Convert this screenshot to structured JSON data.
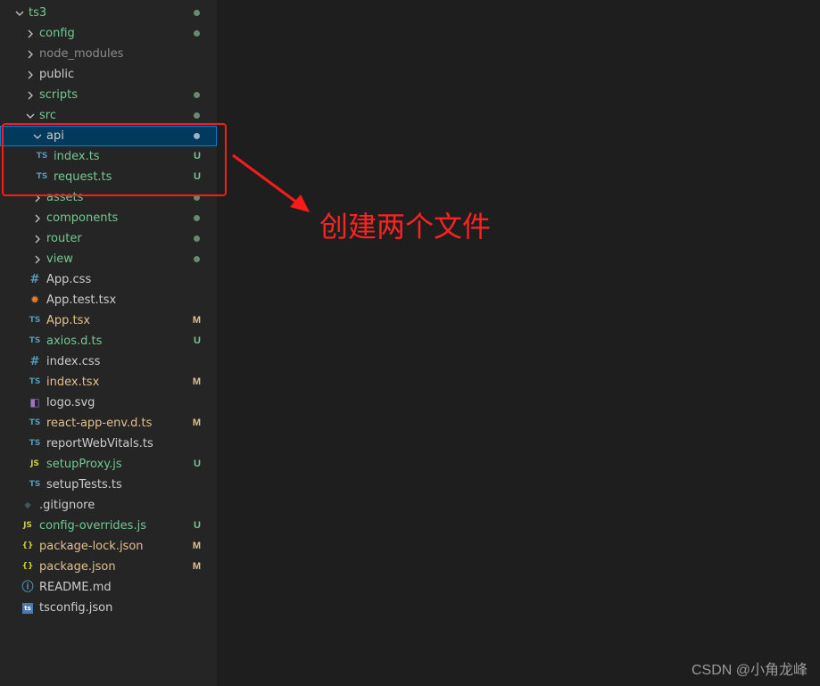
{
  "colors": {
    "untracked": "#73c991",
    "modified": "#e2c08d",
    "ignored": "#8c8c8c",
    "normal": "#cccccc",
    "highlight_red": "#ff1a1a",
    "selection_bg": "#04395e"
  },
  "explorer": {
    "items": [
      {
        "label": "ts3",
        "kind": "folder",
        "open": true,
        "depth": 0,
        "color": "green",
        "marker": "dot"
      },
      {
        "label": "config",
        "kind": "folder",
        "open": false,
        "depth": 1,
        "color": "green",
        "marker": "dot"
      },
      {
        "label": "node_modules",
        "kind": "folder",
        "open": false,
        "depth": 1,
        "color": "gray",
        "marker": ""
      },
      {
        "label": "public",
        "kind": "folder",
        "open": false,
        "depth": 1,
        "color": "white",
        "marker": ""
      },
      {
        "label": "scripts",
        "kind": "folder",
        "open": false,
        "depth": 1,
        "color": "green",
        "marker": "dot"
      },
      {
        "label": "src",
        "kind": "folder",
        "open": true,
        "depth": 1,
        "color": "green",
        "marker": "dot"
      },
      {
        "label": "api",
        "kind": "folder",
        "open": true,
        "depth": 2,
        "color": "white",
        "marker": "dot",
        "selected": true
      },
      {
        "label": "index.ts",
        "kind": "file",
        "icon": "TS",
        "iconName": "typescript-icon",
        "depth": 3,
        "color": "green",
        "marker": "U"
      },
      {
        "label": "request.ts",
        "kind": "file",
        "icon": "TS",
        "iconName": "typescript-icon",
        "depth": 3,
        "color": "green",
        "marker": "U"
      },
      {
        "label": "assets",
        "kind": "folder",
        "open": false,
        "depth": 2,
        "color": "green",
        "marker": "dot"
      },
      {
        "label": "components",
        "kind": "folder",
        "open": false,
        "depth": 2,
        "color": "green",
        "marker": "dot"
      },
      {
        "label": "router",
        "kind": "folder",
        "open": false,
        "depth": 2,
        "color": "green",
        "marker": "dot"
      },
      {
        "label": "view",
        "kind": "folder",
        "open": false,
        "depth": 2,
        "color": "green",
        "marker": "dot"
      },
      {
        "label": "App.css",
        "kind": "file",
        "icon": "#",
        "iconName": "css-icon",
        "depth": 2,
        "color": "white",
        "marker": ""
      },
      {
        "label": "App.test.tsx",
        "kind": "file",
        "icon": "✹",
        "iconName": "test-icon",
        "depth": 2,
        "color": "white",
        "marker": ""
      },
      {
        "label": "App.tsx",
        "kind": "file",
        "icon": "TS",
        "iconName": "typescript-icon",
        "depth": 2,
        "color": "orange",
        "marker": "M"
      },
      {
        "label": "axios.d.ts",
        "kind": "file",
        "icon": "TS",
        "iconName": "typescript-icon",
        "depth": 2,
        "color": "green",
        "marker": "U"
      },
      {
        "label": "index.css",
        "kind": "file",
        "icon": "#",
        "iconName": "css-icon",
        "depth": 2,
        "color": "white",
        "marker": ""
      },
      {
        "label": "index.tsx",
        "kind": "file",
        "icon": "TS",
        "iconName": "typescript-icon",
        "depth": 2,
        "color": "orange",
        "marker": "M"
      },
      {
        "label": "logo.svg",
        "kind": "file",
        "icon": "◧",
        "iconName": "svg-icon",
        "depth": 2,
        "color": "white",
        "marker": ""
      },
      {
        "label": "react-app-env.d.ts",
        "kind": "file",
        "icon": "TS",
        "iconName": "typescript-icon",
        "depth": 2,
        "color": "orange",
        "marker": "M"
      },
      {
        "label": "reportWebVitals.ts",
        "kind": "file",
        "icon": "TS",
        "iconName": "typescript-icon",
        "depth": 2,
        "color": "white",
        "marker": ""
      },
      {
        "label": "setupProxy.js",
        "kind": "file",
        "icon": "JS",
        "iconName": "javascript-icon",
        "depth": 2,
        "color": "green",
        "marker": "U"
      },
      {
        "label": "setupTests.ts",
        "kind": "file",
        "icon": "TS",
        "iconName": "typescript-icon",
        "depth": 2,
        "color": "white",
        "marker": ""
      },
      {
        "label": ".gitignore",
        "kind": "file",
        "icon": "◆",
        "iconName": "git-icon",
        "depth": 1,
        "color": "white",
        "marker": ""
      },
      {
        "label": "config-overrides.js",
        "kind": "file",
        "icon": "JS",
        "iconName": "javascript-icon",
        "depth": 1,
        "color": "green",
        "marker": "U"
      },
      {
        "label": "package-lock.json",
        "kind": "file",
        "icon": "{}",
        "iconName": "json-icon",
        "depth": 1,
        "color": "orange",
        "marker": "M"
      },
      {
        "label": "package.json",
        "kind": "file",
        "icon": "{}",
        "iconName": "json-icon",
        "depth": 1,
        "color": "orange",
        "marker": "M"
      },
      {
        "label": "README.md",
        "kind": "file",
        "icon": "ⓘ",
        "iconName": "info-icon",
        "depth": 1,
        "color": "white",
        "marker": ""
      },
      {
        "label": "tsconfig.json",
        "kind": "file",
        "icon": "ts",
        "iconName": "tsconfig-icon",
        "depth": 1,
        "color": "white",
        "marker": ""
      }
    ]
  },
  "annotation": {
    "text": "创建两个文件"
  },
  "watermark": {
    "text": "CSDN @小角龙峰"
  }
}
